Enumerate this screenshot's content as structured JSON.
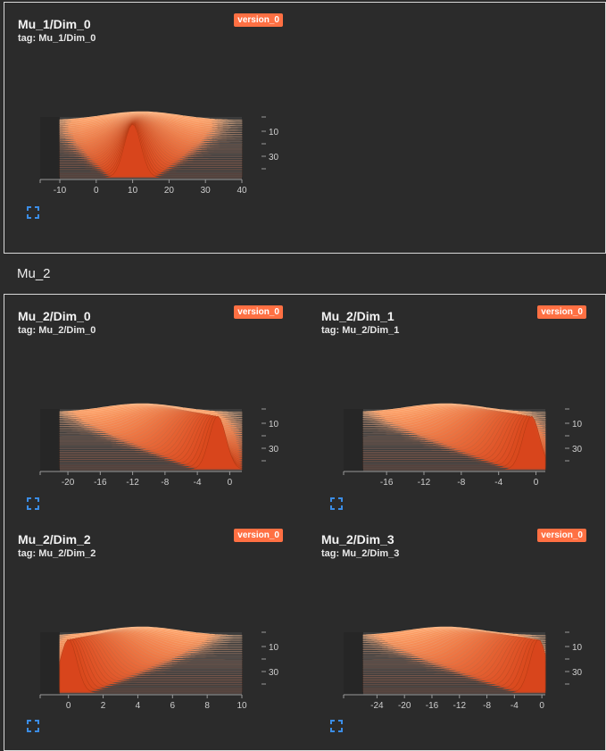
{
  "section": {
    "title": "Mu_2"
  },
  "badge_color": "#ff7043",
  "panels": [
    {
      "id": "mu1-dim0",
      "title": "Mu_1/Dim_0",
      "tag": "tag: Mu_1/Dim_0",
      "badge": "version_0",
      "chart_data": {
        "type": "area",
        "x_ticks": [
          "-10",
          "0",
          "10",
          "20",
          "30",
          "40"
        ],
        "x_range": [
          -10,
          40
        ],
        "y_ticks": [
          "10",
          "30"
        ],
        "peak_x": 10
      }
    },
    {
      "id": "mu2-dim0",
      "title": "Mu_2/Dim_0",
      "tag": "tag: Mu_2/Dim_0",
      "badge": "version_0",
      "chart_data": {
        "type": "area",
        "x_ticks": [
          "-20",
          "-16",
          "-12",
          "-8",
          "-4",
          "0"
        ],
        "x_range": [
          -21,
          1.5
        ],
        "y_ticks": [
          "10",
          "30"
        ],
        "peak_x": -1.5
      }
    },
    {
      "id": "mu2-dim1",
      "title": "Mu_2/Dim_1",
      "tag": "tag: Mu_2/Dim_1",
      "badge": "version_0",
      "chart_data": {
        "type": "area",
        "x_ticks": [
          "-16",
          "-12",
          "-8",
          "-4",
          "0"
        ],
        "x_range": [
          -18.5,
          1
        ],
        "y_ticks": [
          "10",
          "30"
        ],
        "peak_x": -0.5
      }
    },
    {
      "id": "mu2-dim2",
      "title": "Mu_2/Dim_2",
      "tag": "tag: Mu_2/Dim_2",
      "badge": "version_0",
      "chart_data": {
        "type": "area",
        "x_ticks": [
          "0",
          "2",
          "4",
          "6",
          "8",
          "10"
        ],
        "x_range": [
          -0.5,
          10
        ],
        "y_ticks": [
          "10",
          "30"
        ],
        "peak_x": 0
      }
    },
    {
      "id": "mu2-dim3",
      "title": "Mu_2/Dim_3",
      "tag": "tag: Mu_2/Dim_3",
      "badge": "version_0",
      "chart_data": {
        "type": "area",
        "x_ticks": [
          "-24",
          "-20",
          "-16",
          "-12",
          "-8",
          "-4",
          "0"
        ],
        "x_range": [
          -26,
          0.5
        ],
        "y_ticks": [
          "10",
          "30"
        ],
        "peak_x": -0.5
      }
    }
  ]
}
